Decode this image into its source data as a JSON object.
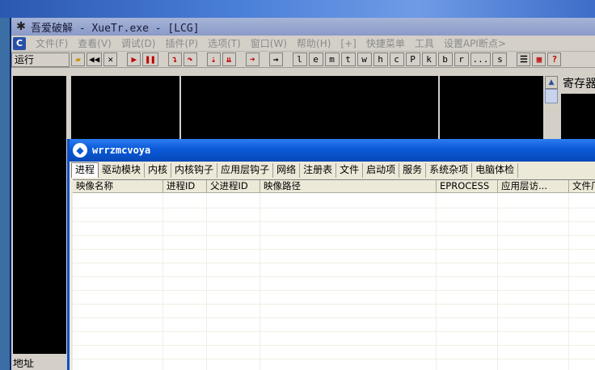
{
  "main_window": {
    "title": "吾爱破解 - XueTr.exe - [LCG]",
    "menu": [
      "文件(F)",
      "查看(V)",
      "调试(D)",
      "插件(P)",
      "选项(T)",
      "窗口(W)",
      "帮助(H)",
      "[+]",
      "快捷菜单",
      "工具",
      "设置API断点>"
    ],
    "menu_logo": "C",
    "status": "运行",
    "toolbar_letters": [
      "l",
      "e",
      "m",
      "t",
      "w",
      "h",
      "c",
      "P",
      "k",
      "b",
      "r",
      "...",
      "s"
    ],
    "registers_label": "寄存器",
    "address_label": "地址"
  },
  "xuetr_window": {
    "title": "wrrzmcvoya",
    "tabs": [
      "进程",
      "驱动模块",
      "内核",
      "内核钩子",
      "应用层钩子",
      "网络",
      "注册表",
      "文件",
      "启动项",
      "服务",
      "系统杂项",
      "电脑体检"
    ],
    "active_tab": "进程",
    "columns": [
      "映像名称",
      "进程ID",
      "父进程ID",
      "映像路径",
      "EPROCESS",
      "应用层访...",
      "文件厂"
    ]
  },
  "colors": {
    "xuetr_title": "#0a5ad8",
    "debugger_pane": "#000000",
    "toolbar_red": "#c00000"
  }
}
